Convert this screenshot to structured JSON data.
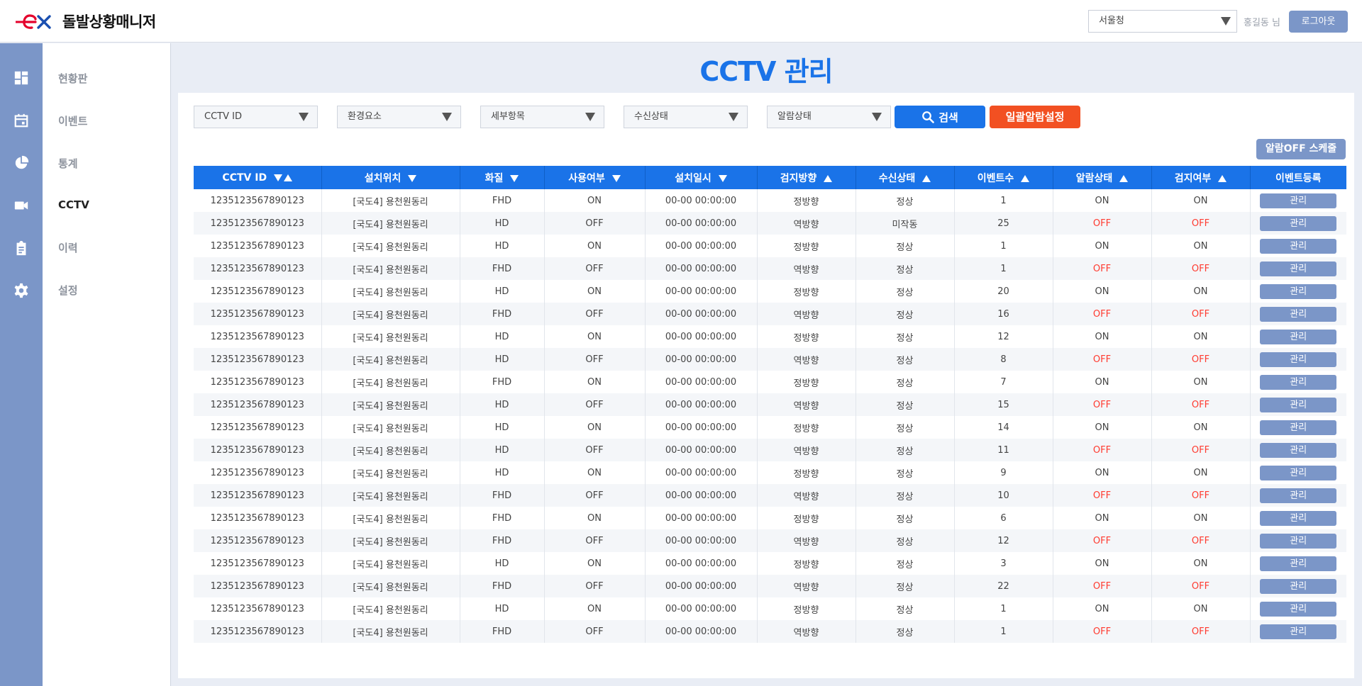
{
  "app": {
    "title": "돌발상황매니저",
    "logo_text": "ex"
  },
  "header": {
    "region": "서울청",
    "user": "홍길동 님",
    "logout_label": "로그아웃"
  },
  "sidebar": {
    "items": [
      {
        "label": "현황판",
        "icon": "dashboard-icon",
        "active": false
      },
      {
        "label": "이벤트",
        "icon": "calendar-icon",
        "active": false
      },
      {
        "label": "통계",
        "icon": "pie-chart-icon",
        "active": false
      },
      {
        "label": "CCTV",
        "icon": "video-camera-icon",
        "active": true
      },
      {
        "label": "이력",
        "icon": "clipboard-icon",
        "active": false
      },
      {
        "label": "설정",
        "icon": "gear-icon",
        "active": false
      }
    ]
  },
  "page": {
    "title": "CCTV 관리"
  },
  "filters": {
    "cctv_id": "CCTV ID",
    "env": "환경요소",
    "detail": "세부항목",
    "receive": "수신상태",
    "alarm": "알람상태",
    "search_label": "검색",
    "bulk_label": "일괄알람설정",
    "alarm_off_schedule_label": "알람OFF 스케줄"
  },
  "table": {
    "columns": [
      "CCTV ID",
      "설치위치",
      "화질",
      "사용여부",
      "설치일시",
      "검지방향",
      "수신상태",
      "이벤트수",
      "알람상태",
      "검지여부",
      "이벤트등록"
    ],
    "manage_label": "관리",
    "rows": [
      [
        "1235123567890123",
        "[국도4] 용천원동리",
        "FHD",
        "ON",
        "00-00 00:00:00",
        "정방향",
        "정상",
        "1",
        "ON",
        "ON"
      ],
      [
        "1235123567890123",
        "[국도4] 용천원동리",
        "HD",
        "OFF",
        "00-00 00:00:00",
        "역방향",
        "미작동",
        "25",
        "OFF",
        "OFF"
      ],
      [
        "1235123567890123",
        "[국도4] 용천원동리",
        "HD",
        "ON",
        "00-00 00:00:00",
        "정방향",
        "정상",
        "1",
        "ON",
        "ON"
      ],
      [
        "1235123567890123",
        "[국도4] 용천원동리",
        "FHD",
        "OFF",
        "00-00 00:00:00",
        "역방향",
        "정상",
        "1",
        "OFF",
        "OFF"
      ],
      [
        "1235123567890123",
        "[국도4] 용천원동리",
        "HD",
        "ON",
        "00-00 00:00:00",
        "정방향",
        "정상",
        "20",
        "ON",
        "ON"
      ],
      [
        "1235123567890123",
        "[국도4] 용천원동리",
        "FHD",
        "OFF",
        "00-00 00:00:00",
        "역방향",
        "정상",
        "16",
        "OFF",
        "OFF"
      ],
      [
        "1235123567890123",
        "[국도4] 용천원동리",
        "HD",
        "ON",
        "00-00 00:00:00",
        "정방향",
        "정상",
        "12",
        "ON",
        "ON"
      ],
      [
        "1235123567890123",
        "[국도4] 용천원동리",
        "HD",
        "OFF",
        "00-00 00:00:00",
        "역방향",
        "정상",
        "8",
        "OFF",
        "OFF"
      ],
      [
        "1235123567890123",
        "[국도4] 용천원동리",
        "FHD",
        "ON",
        "00-00 00:00:00",
        "정방향",
        "정상",
        "7",
        "ON",
        "ON"
      ],
      [
        "1235123567890123",
        "[국도4] 용천원동리",
        "HD",
        "OFF",
        "00-00 00:00:00",
        "역방향",
        "정상",
        "15",
        "OFF",
        "OFF"
      ],
      [
        "1235123567890123",
        "[국도4] 용천원동리",
        "HD",
        "ON",
        "00-00 00:00:00",
        "정방향",
        "정상",
        "14",
        "ON",
        "ON"
      ],
      [
        "1235123567890123",
        "[국도4] 용천원동리",
        "HD",
        "OFF",
        "00-00 00:00:00",
        "역방향",
        "정상",
        "11",
        "OFF",
        "OFF"
      ],
      [
        "1235123567890123",
        "[국도4] 용천원동리",
        "HD",
        "ON",
        "00-00 00:00:00",
        "정방향",
        "정상",
        "9",
        "ON",
        "ON"
      ],
      [
        "1235123567890123",
        "[국도4] 용천원동리",
        "FHD",
        "OFF",
        "00-00 00:00:00",
        "역방향",
        "정상",
        "10",
        "OFF",
        "OFF"
      ],
      [
        "1235123567890123",
        "[국도4] 용천원동리",
        "FHD",
        "ON",
        "00-00 00:00:00",
        "정방향",
        "정상",
        "6",
        "ON",
        "ON"
      ],
      [
        "1235123567890123",
        "[국도4] 용천원동리",
        "FHD",
        "OFF",
        "00-00 00:00:00",
        "역방향",
        "정상",
        "12",
        "OFF",
        "OFF"
      ],
      [
        "1235123567890123",
        "[국도4] 용천원동리",
        "HD",
        "ON",
        "00-00 00:00:00",
        "정방향",
        "정상",
        "3",
        "ON",
        "ON"
      ],
      [
        "1235123567890123",
        "[국도4] 용천원동리",
        "FHD",
        "OFF",
        "00-00 00:00:00",
        "역방향",
        "정상",
        "22",
        "OFF",
        "OFF"
      ],
      [
        "1235123567890123",
        "[국도4] 용천원동리",
        "HD",
        "ON",
        "00-00 00:00:00",
        "정방향",
        "정상",
        "1",
        "ON",
        "ON"
      ],
      [
        "1235123567890123",
        "[국도4] 용천원동리",
        "FHD",
        "OFF",
        "00-00 00:00:00",
        "역방향",
        "정상",
        "1",
        "OFF",
        "OFF"
      ]
    ]
  },
  "colors": {
    "accent": "#1a73e8",
    "sidebar": "#7b96c8",
    "danger": "#ff3b30",
    "bulk": "#f25022",
    "logo_red": "#e4002b"
  }
}
